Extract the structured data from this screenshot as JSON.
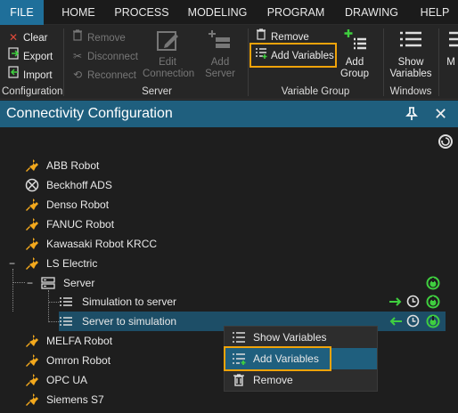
{
  "menu": {
    "tabs": [
      "FILE",
      "HOME",
      "PROCESS",
      "MODELING",
      "PROGRAM",
      "DRAWING",
      "HELP"
    ]
  },
  "ribbon": {
    "configuration": {
      "clear": "Clear",
      "export": "Export",
      "import": "Import",
      "label": "Configuration"
    },
    "server": {
      "remove": "Remove",
      "disconnect": "Disconnect",
      "reconnect": "Reconnect",
      "edit_connection": "Edit Connection",
      "add_server": "Add Server",
      "label": "Server"
    },
    "variable_group": {
      "remove": "Remove",
      "add_variables": "Add Variables",
      "add_group": "Add Group",
      "label": "Variable Group"
    },
    "windows": {
      "show_variables": "Show Variables",
      "label": "Windows"
    },
    "overflow_label": "M"
  },
  "panel": {
    "title": "Connectivity Configuration"
  },
  "tree": {
    "items": [
      {
        "label": "ABB Robot"
      },
      {
        "label": "Beckhoff ADS"
      },
      {
        "label": "Denso Robot"
      },
      {
        "label": "FANUC Robot"
      },
      {
        "label": "Kawasaki Robot KRCC"
      },
      {
        "label": "LS Electric"
      },
      {
        "label": "Server"
      },
      {
        "label": "Simulation to server"
      },
      {
        "label": "Server to simulation"
      },
      {
        "label": "MELFA Robot"
      },
      {
        "label": "Omron Robot"
      },
      {
        "label": "OPC UA"
      },
      {
        "label": "Siemens S7"
      }
    ],
    "expanded_marker": "−"
  },
  "context_menu": {
    "items": [
      {
        "label": "Show Variables"
      },
      {
        "label": "Add Variables"
      },
      {
        "label": "Remove"
      }
    ]
  },
  "colors": {
    "accent": "#1f6f9a",
    "panel_title": "#1f5f7e",
    "highlight": "#f0a30a",
    "plug": "#f2a81d",
    "status_green": "#3fcf3f"
  }
}
